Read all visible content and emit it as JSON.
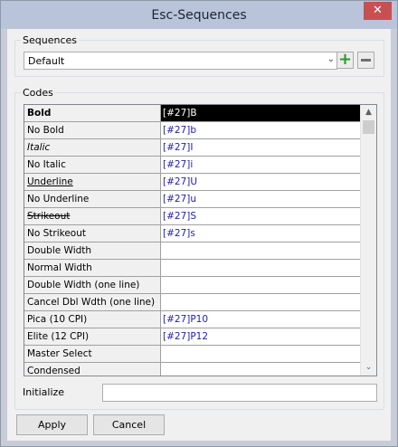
{
  "window": {
    "title": "Esc-Sequences",
    "close_glyph": "✕"
  },
  "sequences": {
    "group_label": "Sequences",
    "selected": "Default",
    "dropdown_arrow": "⌄",
    "add_glyph": "+"
  },
  "codes": {
    "group_label": "Codes",
    "rows": [
      {
        "name": "Bold",
        "code": "[#27]B"
      },
      {
        "name": "No Bold",
        "code": "[#27]b"
      },
      {
        "name": "Italic",
        "code": "[#27]I"
      },
      {
        "name": "No Italic",
        "code": "[#27]i"
      },
      {
        "name": "Underline",
        "code": "[#27]U"
      },
      {
        "name": "No Underline",
        "code": "[#27]u"
      },
      {
        "name": "Strikeout",
        "code": "[#27]S"
      },
      {
        "name": "No Strikeout",
        "code": "[#27]s"
      },
      {
        "name": "Double Width",
        "code": ""
      },
      {
        "name": "Normal Width",
        "code": ""
      },
      {
        "name": "Double Width (one line)",
        "code": ""
      },
      {
        "name": "Cancel Dbl Wdth (one line)",
        "code": ""
      },
      {
        "name": "Pica (10 CPI)",
        "code": "[#27]P10"
      },
      {
        "name": "Elite (12 CPI)",
        "code": "[#27]P12"
      },
      {
        "name": "Master Select",
        "code": ""
      },
      {
        "name": "Condensed",
        "code": ""
      }
    ],
    "scroll_up": "▲",
    "scroll_down": "⌄"
  },
  "initialize": {
    "label": "Initialize",
    "value": ""
  },
  "buttons": {
    "apply": "Apply",
    "cancel": "Cancel"
  }
}
